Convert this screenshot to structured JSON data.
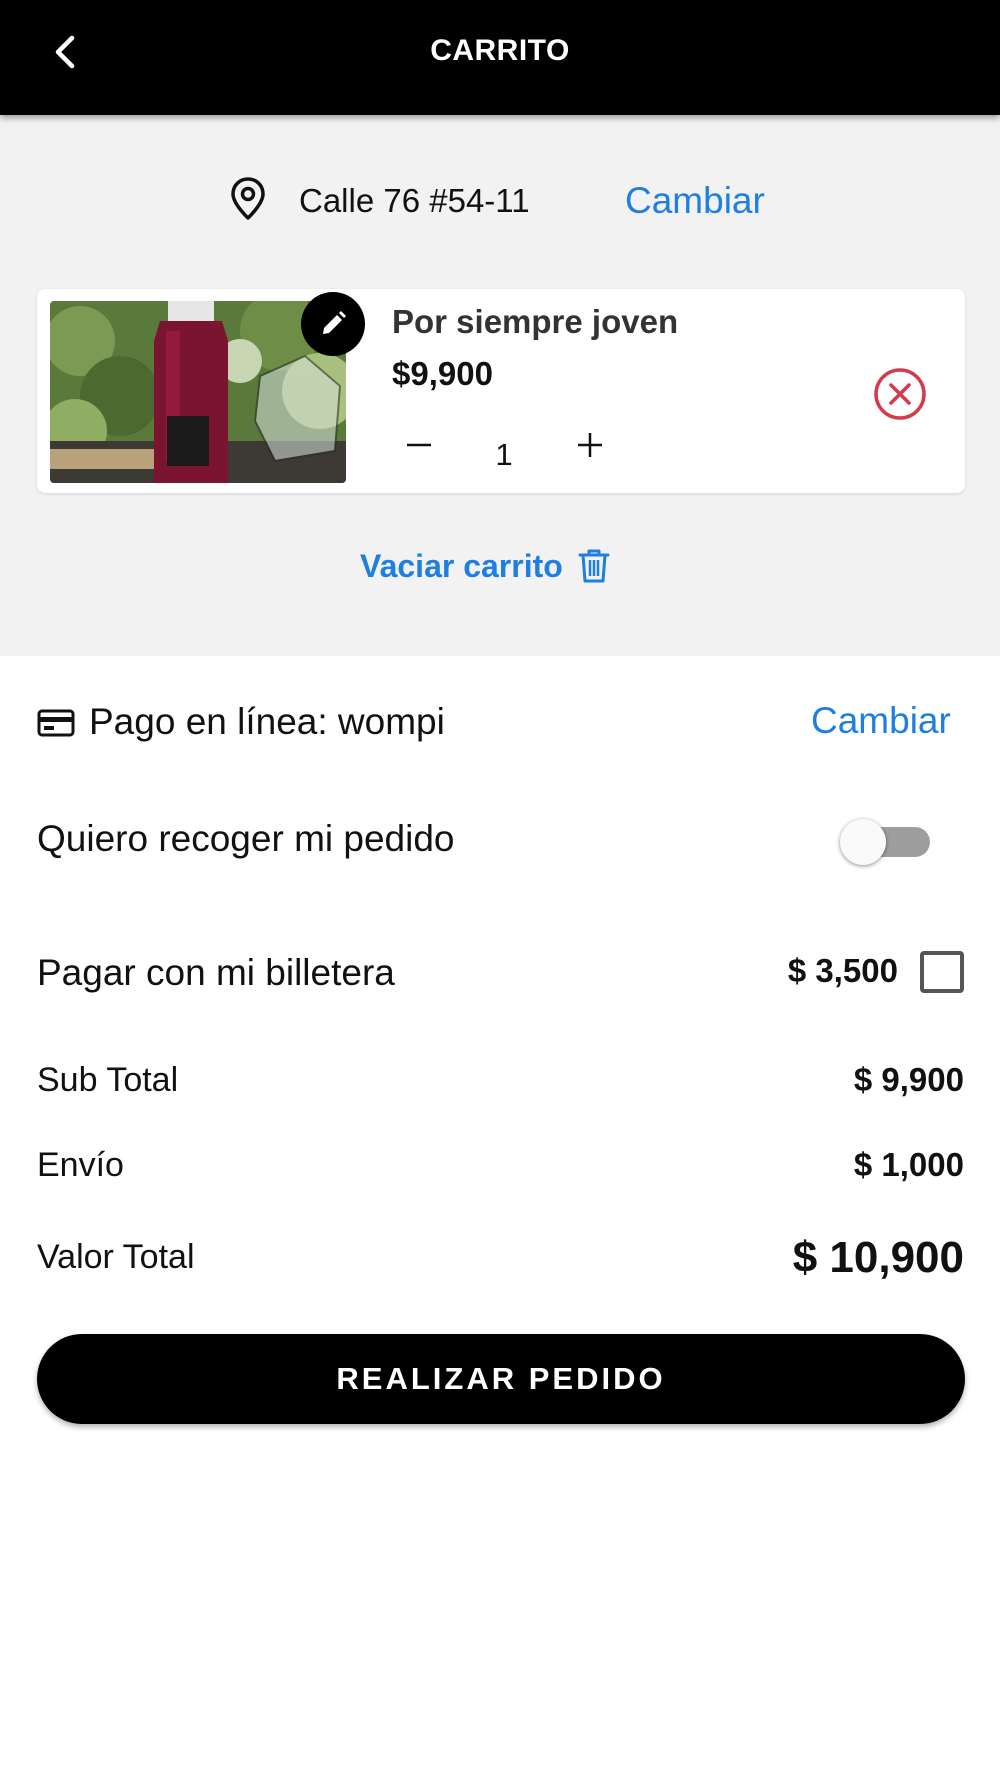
{
  "header": {
    "title": "CARRITO",
    "back_icon": "chevron-left-icon"
  },
  "address": {
    "text": "Calle 76 #54-11",
    "change_label": "Cambiar",
    "icon": "location-pin-icon"
  },
  "cart": {
    "items": [
      {
        "name": "Por siempre joven",
        "price": "$9,900",
        "quantity": "1",
        "image": "bottle-product-image"
      }
    ],
    "empty_label": "Vaciar carrito"
  },
  "payment": {
    "text": "Pago en línea: wompi",
    "change_label": "Cambiar",
    "icon": "credit-card-icon"
  },
  "pickup": {
    "label": "Quiero recoger mi pedido",
    "enabled": false
  },
  "wallet": {
    "label": "Pagar con mi billetera",
    "amount": "$ 3,500",
    "checked": false
  },
  "summary": {
    "subtotal_label": "Sub Total",
    "subtotal_value": "$ 9,900",
    "shipping_label": "Envío",
    "shipping_value": "$ 1,000",
    "total_label": "Valor Total",
    "total_value": "$ 10,900"
  },
  "actions": {
    "order_label": "REALIZAR PEDIDO"
  },
  "colors": {
    "accent": "#1f7fe0",
    "danger": "#d33a4a",
    "appbar": "#000000",
    "background_gray": "#f2f2f2"
  }
}
